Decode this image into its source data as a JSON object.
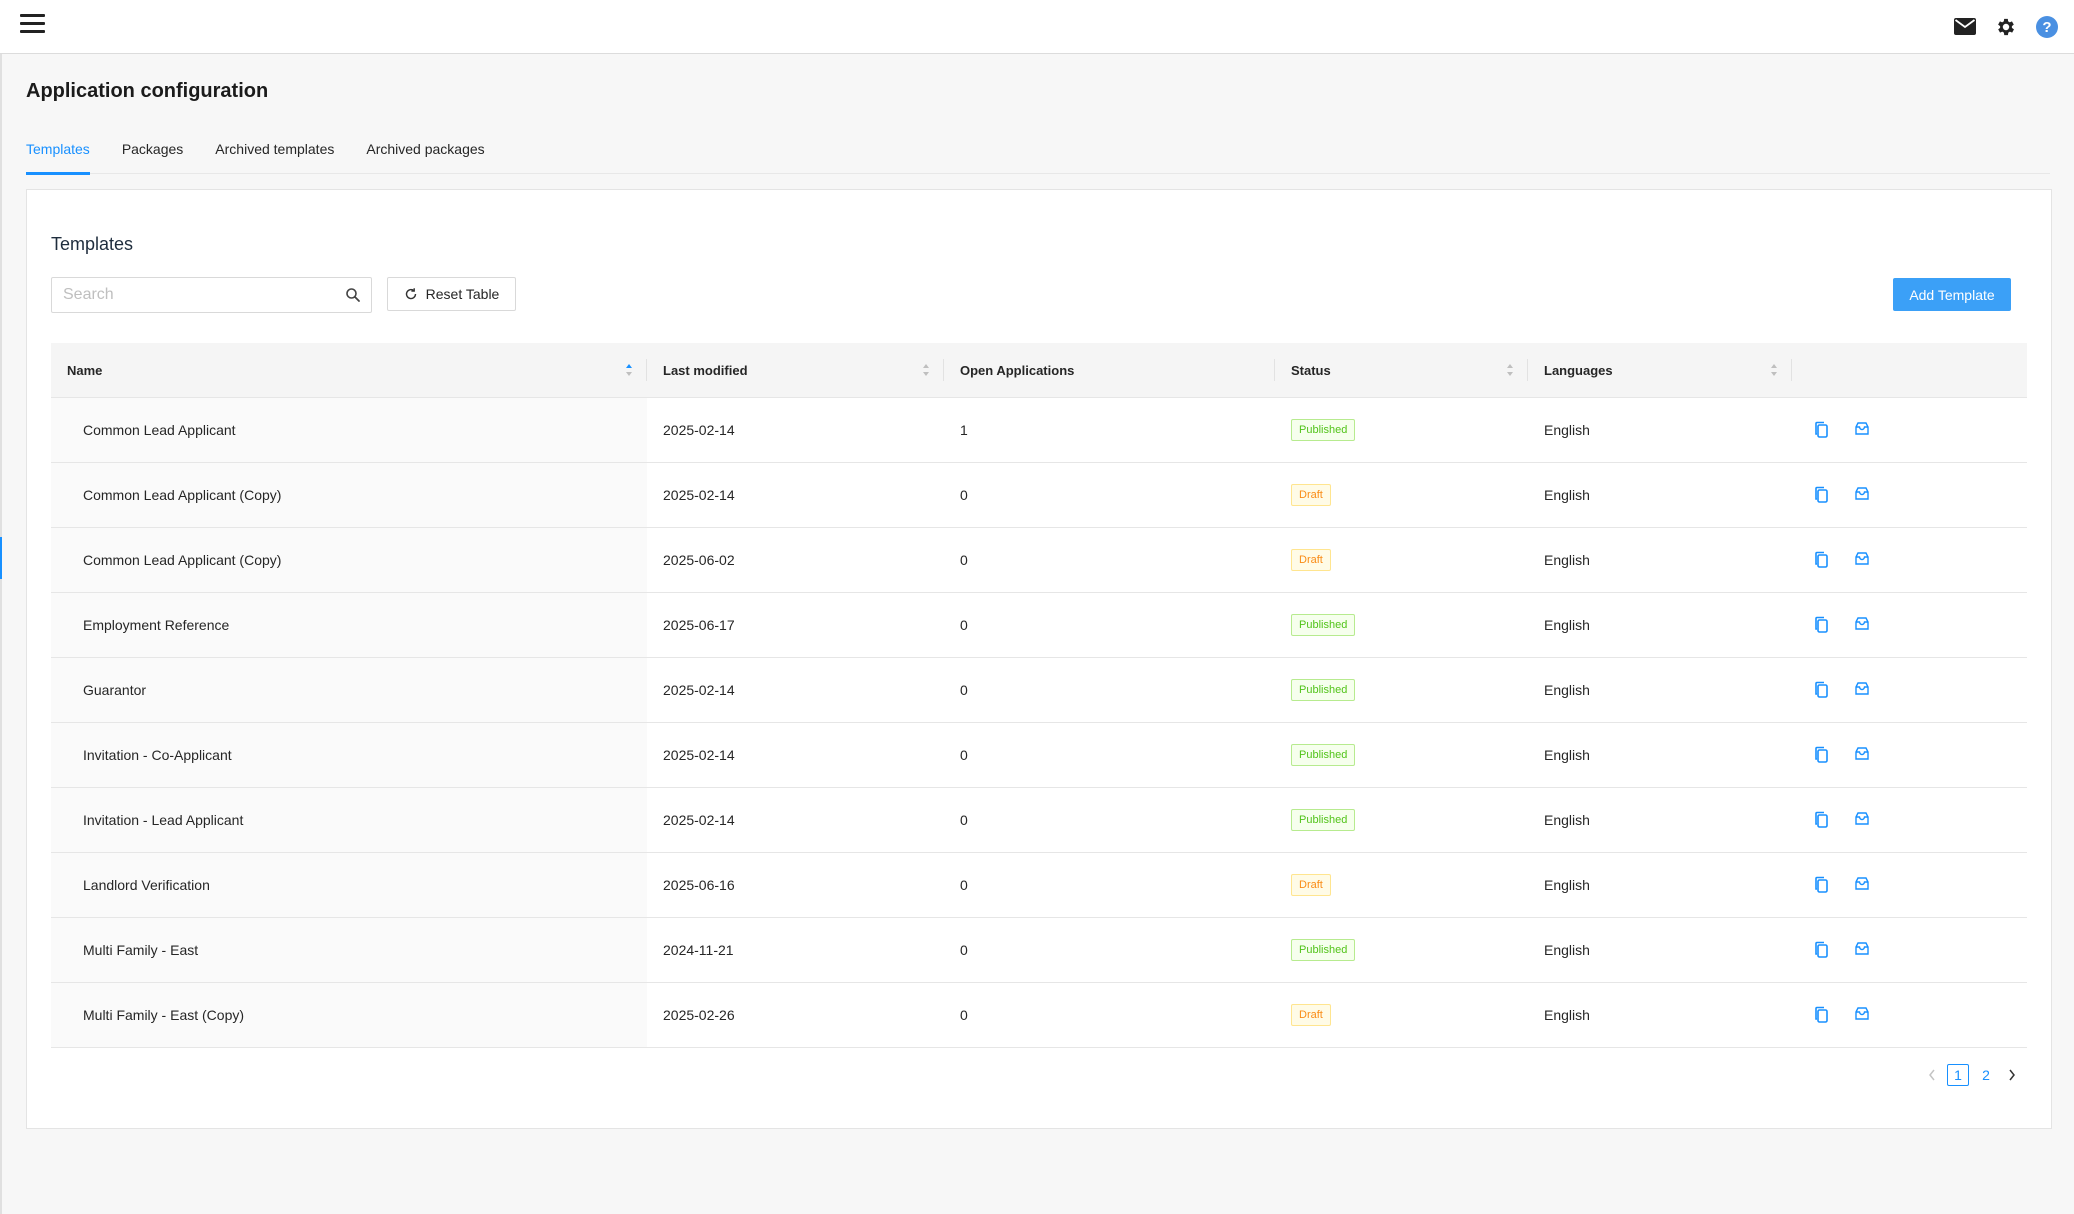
{
  "page": {
    "title": "Application configuration"
  },
  "tabs": [
    {
      "label": "Templates",
      "active": true
    },
    {
      "label": "Packages",
      "active": false
    },
    {
      "label": "Archived templates",
      "active": false
    },
    {
      "label": "Archived packages",
      "active": false
    }
  ],
  "card": {
    "title": "Templates",
    "search_placeholder": "Search",
    "reset_label": "Reset Table",
    "add_label": "Add Template"
  },
  "table": {
    "headers": {
      "name": "Name",
      "last_modified": "Last modified",
      "open_applications": "Open Applications",
      "status": "Status",
      "languages": "Languages"
    },
    "rows": [
      {
        "name": "Common Lead Applicant",
        "last_modified": "2025-02-14",
        "open": "1",
        "status": "Published",
        "language": "English"
      },
      {
        "name": "Common Lead Applicant (Copy)",
        "last_modified": "2025-02-14",
        "open": "0",
        "status": "Draft",
        "language": "English"
      },
      {
        "name": "Common Lead Applicant (Copy)",
        "last_modified": "2025-06-02",
        "open": "0",
        "status": "Draft",
        "language": "English"
      },
      {
        "name": "Employment Reference",
        "last_modified": "2025-06-17",
        "open": "0",
        "status": "Published",
        "language": "English"
      },
      {
        "name": "Guarantor",
        "last_modified": "2025-02-14",
        "open": "0",
        "status": "Published",
        "language": "English"
      },
      {
        "name": "Invitation - Co-Applicant",
        "last_modified": "2025-02-14",
        "open": "0",
        "status": "Published",
        "language": "English"
      },
      {
        "name": "Invitation - Lead Applicant",
        "last_modified": "2025-02-14",
        "open": "0",
        "status": "Published",
        "language": "English"
      },
      {
        "name": "Landlord Verification",
        "last_modified": "2025-06-16",
        "open": "0",
        "status": "Draft",
        "language": "English"
      },
      {
        "name": "Multi Family - East",
        "last_modified": "2024-11-21",
        "open": "0",
        "status": "Published",
        "language": "English"
      },
      {
        "name": "Multi Family - East (Copy)",
        "last_modified": "2025-02-26",
        "open": "0",
        "status": "Draft",
        "language": "English"
      }
    ]
  },
  "pagination": {
    "pages": [
      "1",
      "2"
    ],
    "current": "1"
  },
  "icons": {
    "topbar": [
      "mail-icon",
      "gear-icon",
      "help-icon"
    ],
    "row_actions": [
      "copy-icon",
      "archive-icon"
    ]
  },
  "colors": {
    "accent": "#1890ff",
    "published": "#52c41a",
    "draft": "#fa8c16",
    "add_button": "#3ba0f7"
  }
}
